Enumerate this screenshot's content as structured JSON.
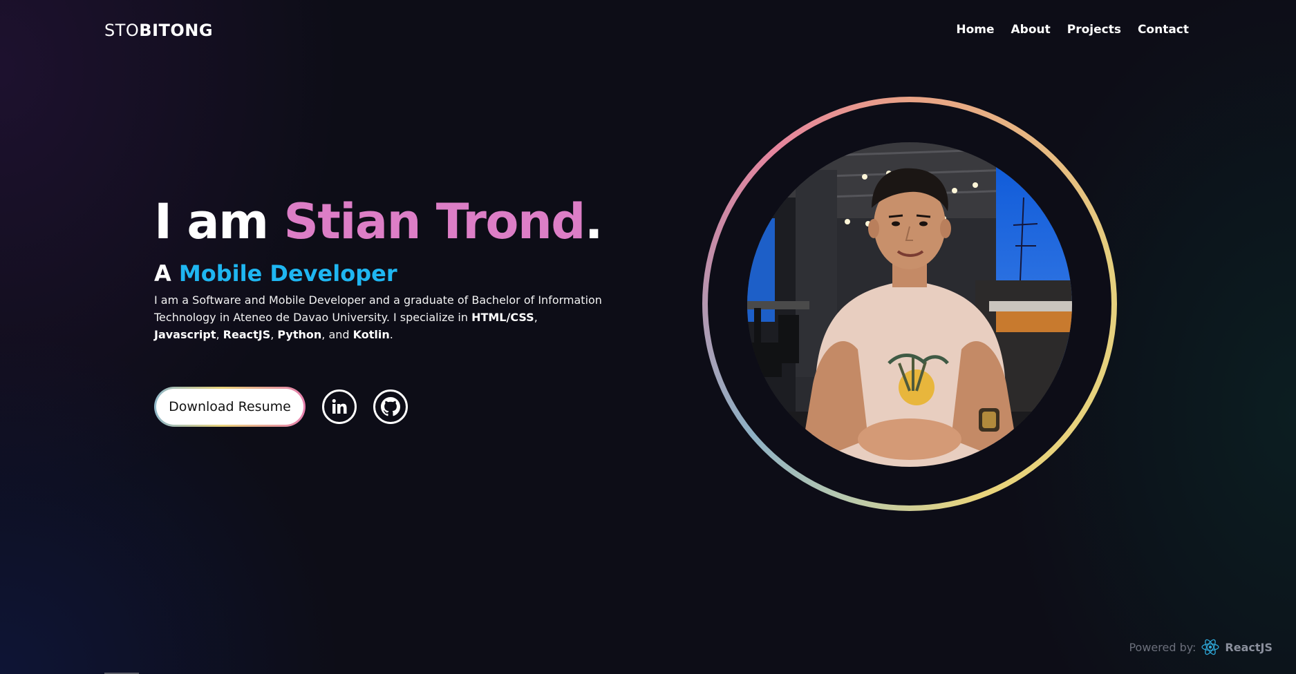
{
  "logo": {
    "light": "STO",
    "bold": "BITONG"
  },
  "nav": {
    "items": [
      "Home",
      "About",
      "Projects",
      "Contact"
    ]
  },
  "hero": {
    "greeting": "I am ",
    "name": "Stian Trond",
    "period": ".",
    "subtitle_prefix": "A ",
    "role": "Mobile Developer",
    "bio": {
      "p1": "I am a Software and Mobile Developer and a graduate of Bachelor of Information Technology in Ateneo de Davao University. I specialize in ",
      "s1": "HTML/CSS",
      "c1": ", ",
      "s2": "Javascript",
      "c2": ", ",
      "s3": "ReactJS",
      "c3": ", ",
      "s4": "Python",
      "c4": ", and ",
      "s5": "Kotlin",
      "end": "."
    }
  },
  "actions": {
    "resume_label": "Download Resume",
    "linkedin_icon": "linkedin-icon",
    "github_icon": "github-icon"
  },
  "footer": {
    "powered_label": "Powered by:",
    "brand": "ReactJS",
    "brand_icon": "react-icon"
  },
  "colors": {
    "background": "#0d0d17",
    "name_accent": "#dc7ec6",
    "role_accent": "#1fb6f1",
    "react": "#2ea8d8"
  }
}
